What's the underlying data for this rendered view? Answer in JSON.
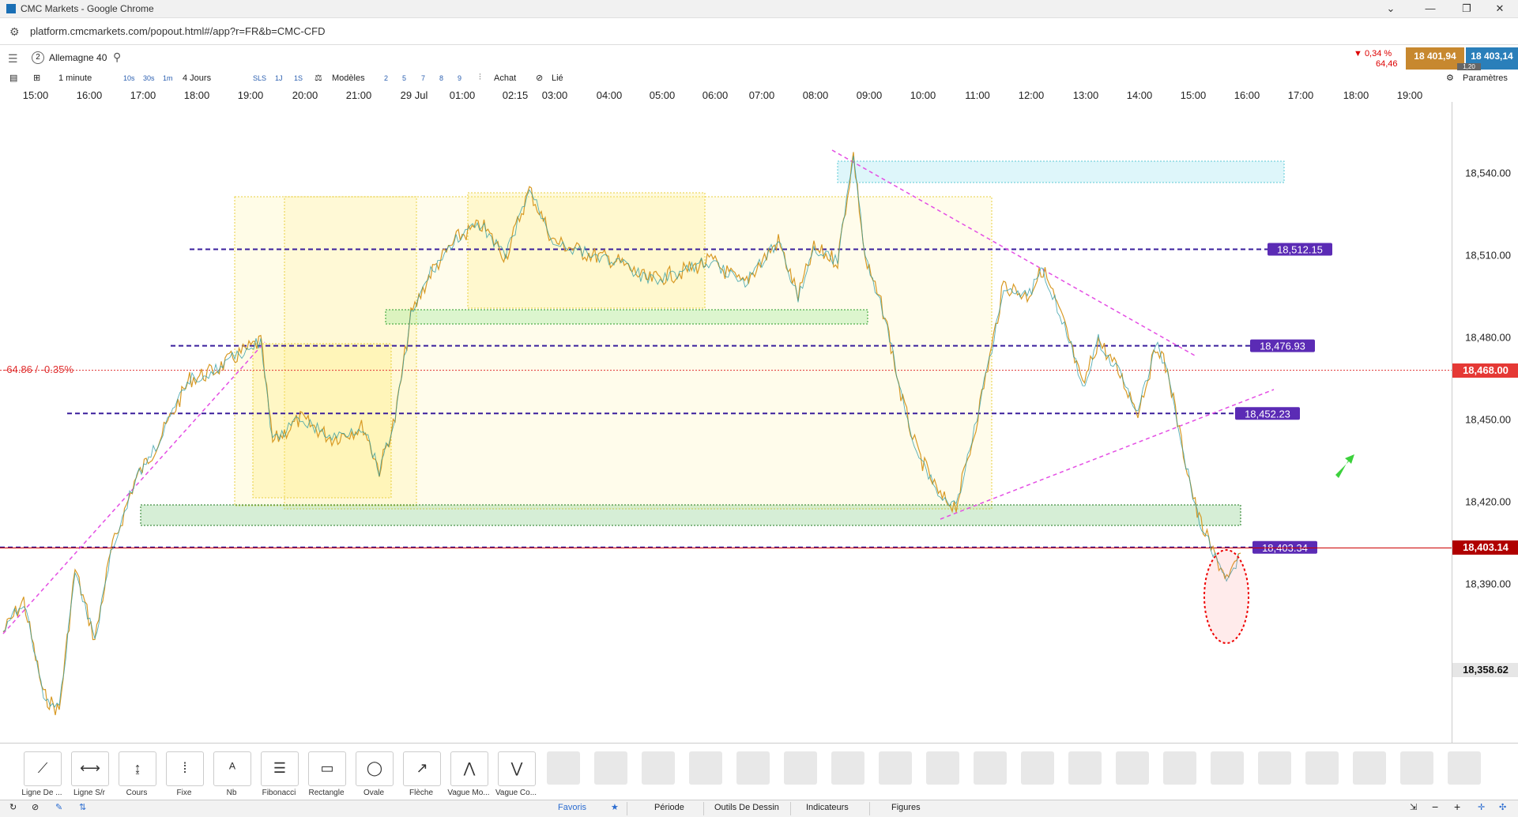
{
  "window": {
    "title": "CMC Markets - Google Chrome",
    "minimize": "—",
    "restore": "❐",
    "close": "✕",
    "extra": "⌄"
  },
  "browser": {
    "url": "platform.cmcmarkets.com/popout.html#/app?r=FR&b=CMC-CFD"
  },
  "instrument": {
    "index": "2",
    "name": "Allemagne 40"
  },
  "quote": {
    "change_pct": "▼ 0,34 %",
    "change_val": "64,46",
    "sell": "18 401,94",
    "buy": "18 403,14",
    "spread": "1,20"
  },
  "toolbar": {
    "interval": "1 minute",
    "intervals": [
      "10s",
      "30s",
      "1m"
    ],
    "range": "4 Jours",
    "modes": [
      "SLS",
      "1J",
      "1S"
    ],
    "models": "Modèles",
    "counts": [
      "2",
      "5",
      "7",
      "8",
      "9"
    ],
    "buy": "Achat",
    "link": "Lié",
    "settings": "Paramètres"
  },
  "time_axis": [
    "15:00",
    "16:00",
    "17:00",
    "18:00",
    "19:00",
    "20:00",
    "21:00",
    "29 Jul",
    "01:00",
    "02:15",
    "03:00",
    "04:00",
    "05:00",
    "06:00",
    "07:00",
    "08:00",
    "09:00",
    "10:00",
    "11:00",
    "12:00",
    "13:00",
    "14:00",
    "15:00",
    "16:00",
    "17:00",
    "18:00",
    "19:00"
  ],
  "price_axis": [
    "18,540.00",
    "18,510.00",
    "18,480.00",
    "18,450.00",
    "18,420.00",
    "18,390.00"
  ],
  "price_tags": {
    "prev_close": "18,468.00",
    "current": "18,403.14",
    "low": "18,358.62",
    "change_label": "-64.86 / -0.35%"
  },
  "level_labels": [
    "18,512.15",
    "18,476.93",
    "18,452.23",
    "18,403.34"
  ],
  "colors": {
    "sell": "#c7882f",
    "buy": "#2a7fba",
    "level": "#3a1f9c",
    "prev_close": "#e03030",
    "current": "#cc0000",
    "trend": "#e44ee4"
  },
  "chart_data": {
    "type": "line",
    "instrument": "Allemagne 40",
    "interval": "1 minute",
    "x": [
      "15:00",
      "16:00",
      "17:00",
      "18:00",
      "19:00",
      "20:00",
      "21:00",
      "29 Jul",
      "01:00",
      "02:15",
      "03:00",
      "04:00",
      "05:00",
      "06:00",
      "07:00",
      "08:00",
      "09:00",
      "10:00",
      "11:00",
      "12:00",
      "13:00",
      "14:00",
      "15:00",
      "16:00"
    ],
    "y": [
      18385,
      18372,
      18430,
      18460,
      18478,
      18440,
      18438,
      18470,
      18500,
      18520,
      18522,
      18510,
      18500,
      18505,
      18498,
      18508,
      18515,
      18470,
      18430,
      18500,
      18485,
      18465,
      18450,
      18395
    ],
    "ylim": [
      18340,
      18570
    ],
    "horizontal_levels": [
      18512.15,
      18476.93,
      18452.23,
      18403.34
    ],
    "previous_close": 18468.0,
    "last_price": 18403.14,
    "cursor_price": 18358.62
  },
  "drawing_tools": [
    {
      "name": "line-tool",
      "label": "Ligne De ..."
    },
    {
      "name": "segment-tool",
      "label": "Ligne S/r"
    },
    {
      "name": "price-tool",
      "label": "Cours"
    },
    {
      "name": "fixed-tool",
      "label": "Fixe"
    },
    {
      "name": "text-tool",
      "label": "Nb"
    },
    {
      "name": "fibonacci-tool",
      "label": "Fibonacci"
    },
    {
      "name": "rectangle-tool",
      "label": "Rectangle"
    },
    {
      "name": "oval-tool",
      "label": "Ovale"
    },
    {
      "name": "arrow-tool",
      "label": "Flèche"
    },
    {
      "name": "wave-mo-tool",
      "label": "Vague Mo..."
    },
    {
      "name": "wave-co-tool",
      "label": "Vague Co..."
    }
  ],
  "bottom_tabs": [
    "Favoris",
    "Période",
    "Outils De Dessin",
    "Indicateurs",
    "Figures"
  ]
}
